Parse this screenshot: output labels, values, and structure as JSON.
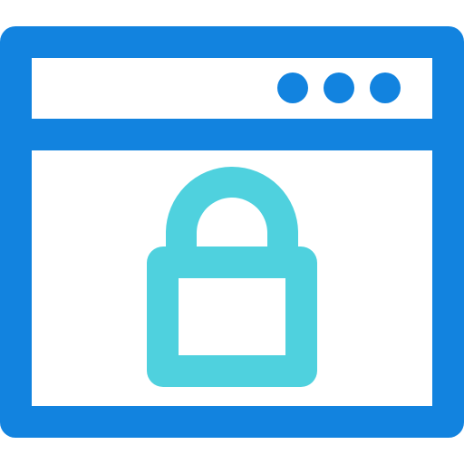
{
  "icon": {
    "name": "secure-browser-window-icon",
    "colors": {
      "window": "#1283DF",
      "lock": "#4FD1DE",
      "background": "#FFFFFF"
    },
    "window_controls": {
      "count": 3,
      "icon_names": [
        "dot-icon",
        "dot-icon",
        "dot-icon"
      ]
    },
    "content_icon": "padlock-icon"
  }
}
